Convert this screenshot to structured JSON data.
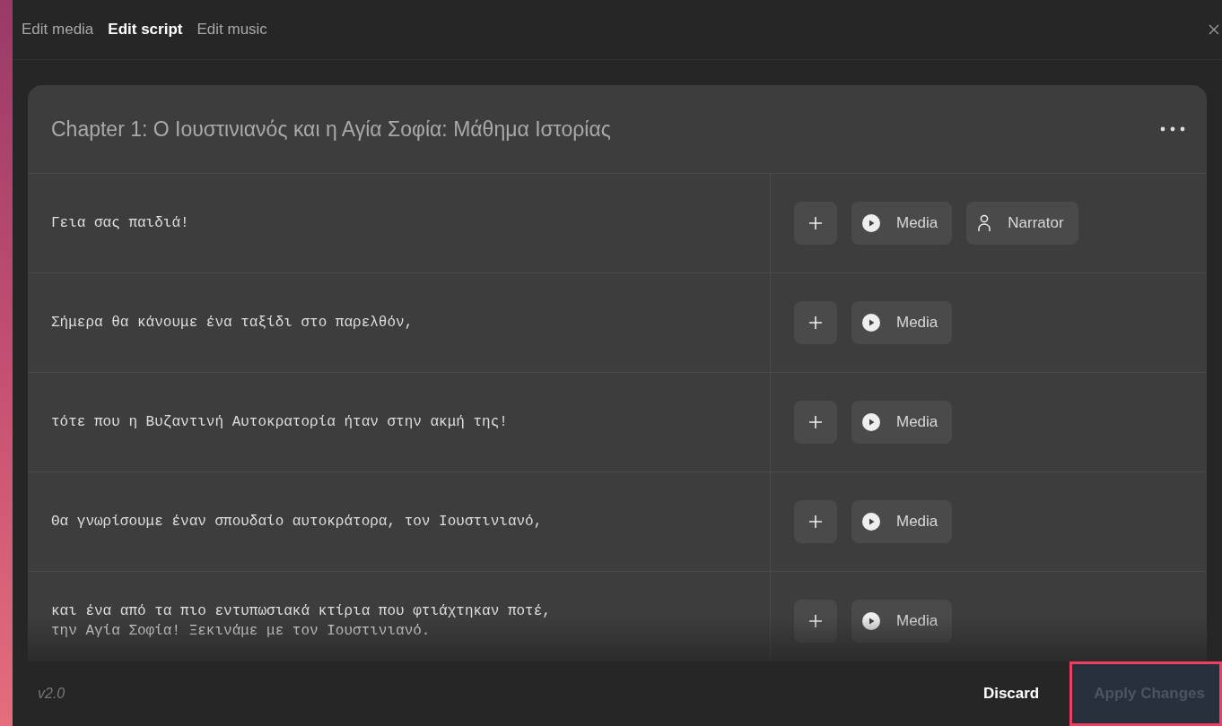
{
  "tabs": [
    {
      "label": "Edit media",
      "selected": false
    },
    {
      "label": "Edit script",
      "selected": true
    },
    {
      "label": "Edit music",
      "selected": false
    }
  ],
  "chapter": {
    "title": "Chapter 1: Ο Ιουστινιανός και η Αγία Σοφία: Μάθημα Ιστορίας"
  },
  "rows": [
    {
      "lines": [
        "Γεια σας παιδιά!"
      ],
      "actions": [
        {
          "kind": "add"
        },
        {
          "kind": "media",
          "label": "Media"
        },
        {
          "kind": "narrator",
          "label": "Narrator"
        }
      ]
    },
    {
      "lines": [
        "Σήμερα θα κάνουμε ένα ταξίδι στο παρελθόν,"
      ],
      "actions": [
        {
          "kind": "add"
        },
        {
          "kind": "media",
          "label": "Media"
        }
      ]
    },
    {
      "lines": [
        "τότε που η Βυζαντινή Αυτοκρατορία ήταν στην ακμή της!"
      ],
      "actions": [
        {
          "kind": "add"
        },
        {
          "kind": "media",
          "label": "Media"
        }
      ]
    },
    {
      "lines": [
        "Θα γνωρίσουμε έναν σπουδαίο αυτοκράτορα, τον Ιουστινιανό,"
      ],
      "actions": [
        {
          "kind": "add"
        },
        {
          "kind": "media",
          "label": "Media"
        }
      ]
    },
    {
      "lines": [
        "και ένα από τα πιο εντυπωσιακά κτίρια που φτιάχτηκαν ποτέ,",
        "την Αγία Σοφία! Ξεκινάμε με τον Ιουστινιανό."
      ],
      "actions": [
        {
          "kind": "add"
        },
        {
          "kind": "media",
          "label": "Media"
        }
      ]
    }
  ],
  "footer": {
    "version": "v2.0",
    "discard": "Discard",
    "apply": {
      "label": "Apply Changes",
      "disabled": true,
      "highlighted": true
    }
  }
}
